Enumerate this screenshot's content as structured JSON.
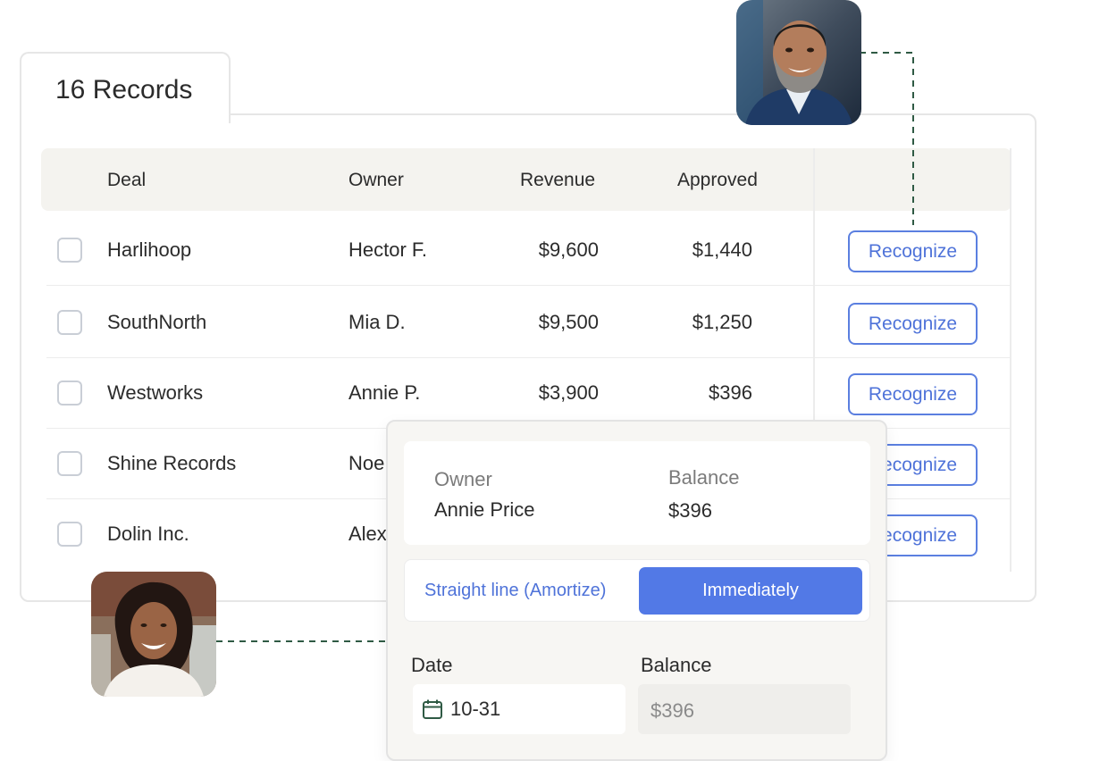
{
  "records_tab": {
    "label": "16 Records"
  },
  "table": {
    "headers": [
      "Deal",
      "Owner",
      "Revenue",
      "Approved"
    ],
    "action_label": "Recognize",
    "rows": [
      {
        "deal": "Harlihoop",
        "owner": "Hector F.",
        "revenue": "$9,600",
        "approved": "$1,440"
      },
      {
        "deal": "SouthNorth",
        "owner": "Mia D.",
        "revenue": "$9,500",
        "approved": "$1,250"
      },
      {
        "deal": "Westworks",
        "owner": "Annie P.",
        "revenue": "$3,900",
        "approved": "$396"
      },
      {
        "deal": "Shine Records",
        "owner": "Noe"
      },
      {
        "deal": "Dolin Inc.",
        "owner": "Alex"
      }
    ]
  },
  "popup": {
    "owner_label": "Owner",
    "owner_value": "Annie Price",
    "balance_label": "Balance",
    "balance_value": "$396",
    "option_amortize": "Straight line (Amortize)",
    "option_immediately": "Immediately",
    "date_label": "Date",
    "date_value": "10-31",
    "balance_field_label": "Balance",
    "balance_field_value": "$396"
  },
  "colors": {
    "accent": "#5279e6",
    "link": "#4f73d9",
    "header_bg": "#f4f3ef",
    "dash_line": "#2f5a44"
  },
  "icons": [
    "calendar-icon",
    "checkbox"
  ]
}
